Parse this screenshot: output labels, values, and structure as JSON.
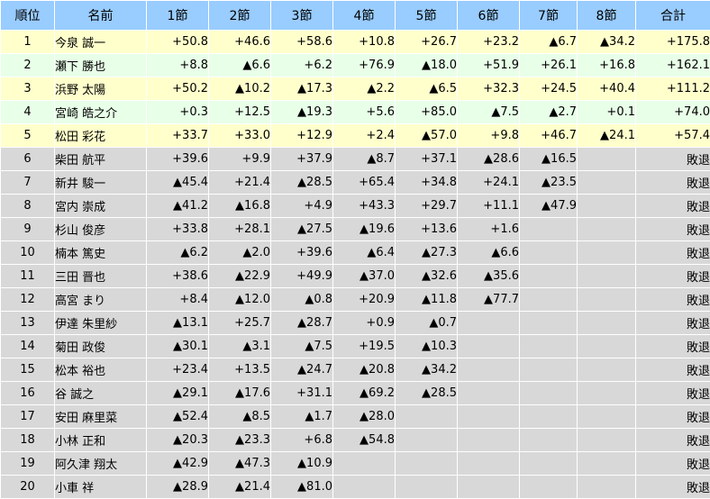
{
  "header": {
    "rank": "順位",
    "name": "名前",
    "rounds": [
      "1節",
      "2節",
      "3節",
      "4節",
      "5節",
      "6節",
      "7節",
      "8節"
    ],
    "total": "合計"
  },
  "colors": {
    "header_bg": "#99ccff",
    "advance_row_a": "#ffffcc",
    "advance_row_b": "#e8ffe8",
    "eliminated_row": "#d8d8d8"
  },
  "rows": [
    {
      "rank": "1",
      "name": "今泉 誠一",
      "scores": [
        "+50.8",
        "+46.6",
        "+58.6",
        "+10.8",
        "+26.7",
        "+23.2",
        "▲6.7",
        "▲34.2"
      ],
      "total": "+175.8",
      "status": "advance"
    },
    {
      "rank": "2",
      "name": "瀬下 勝也",
      "scores": [
        "+8.8",
        "▲6.6",
        "+6.2",
        "+76.9",
        "▲18.0",
        "+51.9",
        "+26.1",
        "+16.8"
      ],
      "total": "+162.1",
      "status": "advance"
    },
    {
      "rank": "3",
      "name": "浜野 太陽",
      "scores": [
        "+50.2",
        "▲10.2",
        "▲17.3",
        "▲2.2",
        "▲6.5",
        "+32.3",
        "+24.5",
        "+40.4"
      ],
      "total": "+111.2",
      "status": "advance"
    },
    {
      "rank": "4",
      "name": "宮崎 皓之介",
      "scores": [
        "+0.3",
        "+12.5",
        "▲19.3",
        "+5.6",
        "+85.0",
        "▲7.5",
        "▲2.7",
        "+0.1"
      ],
      "total": "+74.0",
      "status": "advance"
    },
    {
      "rank": "5",
      "name": "松田 彩花",
      "scores": [
        "+33.7",
        "+33.0",
        "+12.9",
        "+2.4",
        "▲57.0",
        "+9.8",
        "+46.7",
        "▲24.1"
      ],
      "total": "+57.4",
      "status": "advance"
    },
    {
      "rank": "6",
      "name": "柴田 航平",
      "scores": [
        "+39.6",
        "+9.9",
        "+37.9",
        "▲8.7",
        "+37.1",
        "▲28.6",
        "▲16.5",
        ""
      ],
      "total": "敗退",
      "status": "out"
    },
    {
      "rank": "7",
      "name": "新井 駿一",
      "scores": [
        "▲45.4",
        "+21.4",
        "▲28.5",
        "+65.4",
        "+34.8",
        "+24.1",
        "▲23.5",
        ""
      ],
      "total": "敗退",
      "status": "out"
    },
    {
      "rank": "8",
      "name": "宮内 崇成",
      "scores": [
        "▲41.2",
        "▲16.8",
        "+4.9",
        "+43.3",
        "+29.7",
        "+11.1",
        "▲47.9",
        ""
      ],
      "total": "敗退",
      "status": "out"
    },
    {
      "rank": "9",
      "name": "杉山 俊彦",
      "scores": [
        "+33.8",
        "+28.1",
        "▲27.5",
        "▲19.6",
        "+13.6",
        "+1.6",
        "",
        ""
      ],
      "total": "敗退",
      "status": "out"
    },
    {
      "rank": "10",
      "name": "楠本 篤史",
      "scores": [
        "▲6.2",
        "▲2.0",
        "+39.6",
        "▲6.4",
        "▲27.3",
        "▲6.6",
        "",
        ""
      ],
      "total": "敗退",
      "status": "out"
    },
    {
      "rank": "11",
      "name": "三田 晋也",
      "scores": [
        "+38.6",
        "▲22.9",
        "+49.9",
        "▲37.0",
        "▲32.6",
        "▲35.6",
        "",
        ""
      ],
      "total": "敗退",
      "status": "out"
    },
    {
      "rank": "12",
      "name": "高宮 まり",
      "scores": [
        "+8.4",
        "▲12.0",
        "▲0.8",
        "+20.9",
        "▲11.8",
        "▲77.7",
        "",
        ""
      ],
      "total": "敗退",
      "status": "out"
    },
    {
      "rank": "13",
      "name": "伊達 朱里紗",
      "scores": [
        "▲13.1",
        "+25.7",
        "▲28.7",
        "+0.9",
        "▲0.7",
        "",
        "",
        ""
      ],
      "total": "敗退",
      "status": "out"
    },
    {
      "rank": "14",
      "name": "菊田 政俊",
      "scores": [
        "▲30.1",
        "▲3.1",
        "▲7.5",
        "+19.5",
        "▲10.3",
        "",
        "",
        ""
      ],
      "total": "敗退",
      "status": "out"
    },
    {
      "rank": "15",
      "name": "松本 裕也",
      "scores": [
        "+23.4",
        "+13.5",
        "▲24.7",
        "▲20.8",
        "▲34.2",
        "",
        "",
        ""
      ],
      "total": "敗退",
      "status": "out"
    },
    {
      "rank": "16",
      "name": "谷 誠之",
      "scores": [
        "▲29.1",
        "▲17.6",
        "+31.1",
        "▲69.2",
        "▲28.5",
        "",
        "",
        ""
      ],
      "total": "敗退",
      "status": "out"
    },
    {
      "rank": "17",
      "name": "安田 麻里菜",
      "scores": [
        "▲52.4",
        "▲8.5",
        "▲1.7",
        "▲28.0",
        "",
        "",
        "",
        ""
      ],
      "total": "敗退",
      "status": "out"
    },
    {
      "rank": "18",
      "name": "小林 正和",
      "scores": [
        "▲20.3",
        "▲23.3",
        "+6.8",
        "▲54.8",
        "",
        "",
        "",
        ""
      ],
      "total": "敗退",
      "status": "out"
    },
    {
      "rank": "19",
      "name": "阿久津 翔太",
      "scores": [
        "▲42.9",
        "▲47.3",
        "▲10.9",
        "",
        "",
        "",
        "",
        ""
      ],
      "total": "敗退",
      "status": "out"
    },
    {
      "rank": "20",
      "name": "小車 祥",
      "scores": [
        "▲28.9",
        "▲21.4",
        "▲81.0",
        "",
        "",
        "",
        "",
        ""
      ],
      "total": "敗退",
      "status": "out"
    }
  ]
}
